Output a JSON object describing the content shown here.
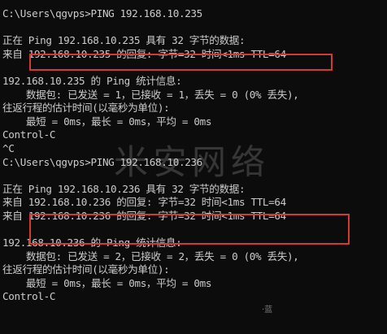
{
  "console": {
    "lines": [
      "C:\\Users\\qgvps>PING 192.168.10.235",
      "",
      "正在 Ping 192.168.10.235 具有 32 字节的数据:",
      "来自 192.168.10.235 的回复: 字节=32 时间<1ms TTL=64",
      "",
      "192.168.10.235 的 Ping 统计信息:",
      "    数据包: 已发送 = 1，已接收 = 1，丢失 = 0 (0% 丢失),",
      "往返行程的估计时间(以毫秒为单位):",
      "    最短 = 0ms，最长 = 0ms，平均 = 0ms",
      "Control-C",
      "^C",
      "C:\\Users\\qgvps>PING 192.168.10.236",
      "",
      "正在 Ping 192.168.10.236 具有 32 字节的数据:",
      "来自 192.168.10.236 的回复: 字节=32 时间<1ms TTL=64",
      "来自 192.168.10.236 的回复: 字节=32 时间<1ms TTL=64",
      "",
      "192.168.10.236 的 Ping 统计信息:",
      "    数据包: 已发送 = 2，已接收 = 2，丢失 = 0 (0% 丢失),",
      "往返行程的估计时间(以毫秒为单位):",
      "    最短 = 0ms，最长 = 0ms，平均 = 0ms",
      "Control-C"
    ]
  },
  "watermark": "米安网络",
  "corner_mark": "·蓝",
  "colors": {
    "background": "#0c0c0c",
    "text": "#cccccc",
    "highlight_box": "#d23a35"
  }
}
